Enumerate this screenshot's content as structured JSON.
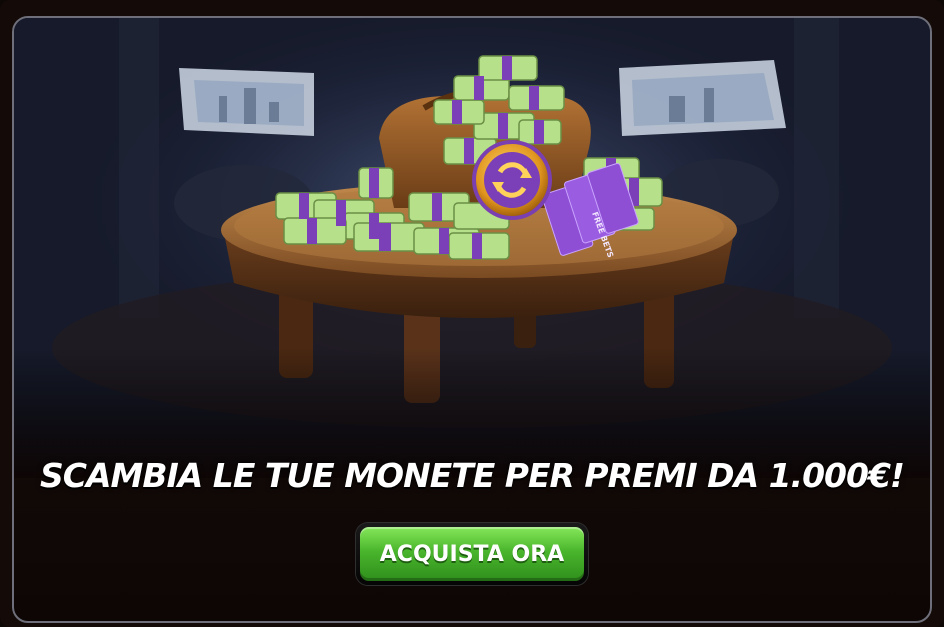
{
  "banner": {
    "headline": "SCAMBIA LE TUE MONETE PER PREMI DA 1.000€!",
    "cta_label": "ACQUISTA ORA",
    "ticket_text": "FREE BETS"
  },
  "colors": {
    "button_green": "#49b52c",
    "money_green": "#b7e08a",
    "money_band": "#7b3fb8",
    "coin_gold": "#e8a92a",
    "table_wood": "#8a5a2c"
  }
}
